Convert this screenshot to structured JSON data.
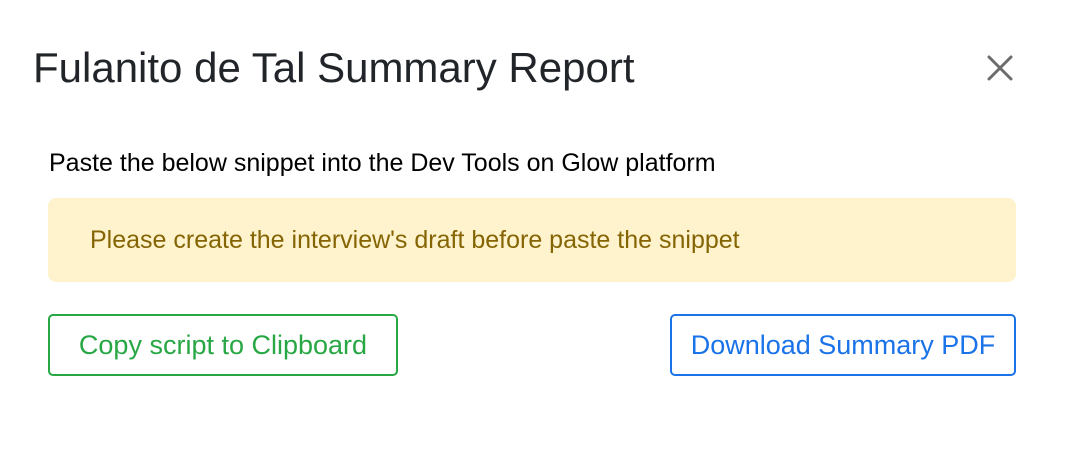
{
  "modal": {
    "title": "Fulanito de Tal Summary Report",
    "close_icon": "close-icon",
    "instruction": "Paste the below snippet into the Dev Tools on Glow platform",
    "alert": {
      "text": "Please create the interview's draft before paste the snippet"
    },
    "buttons": {
      "copy_label": "Copy script to Clipboard",
      "download_label": "Download Summary PDF"
    }
  },
  "colors": {
    "alert_background": "#fff3cd",
    "alert_text": "#856404",
    "copy_button": "#28a745",
    "download_button": "#1a73e8",
    "close_icon": "#6c6c6c"
  }
}
